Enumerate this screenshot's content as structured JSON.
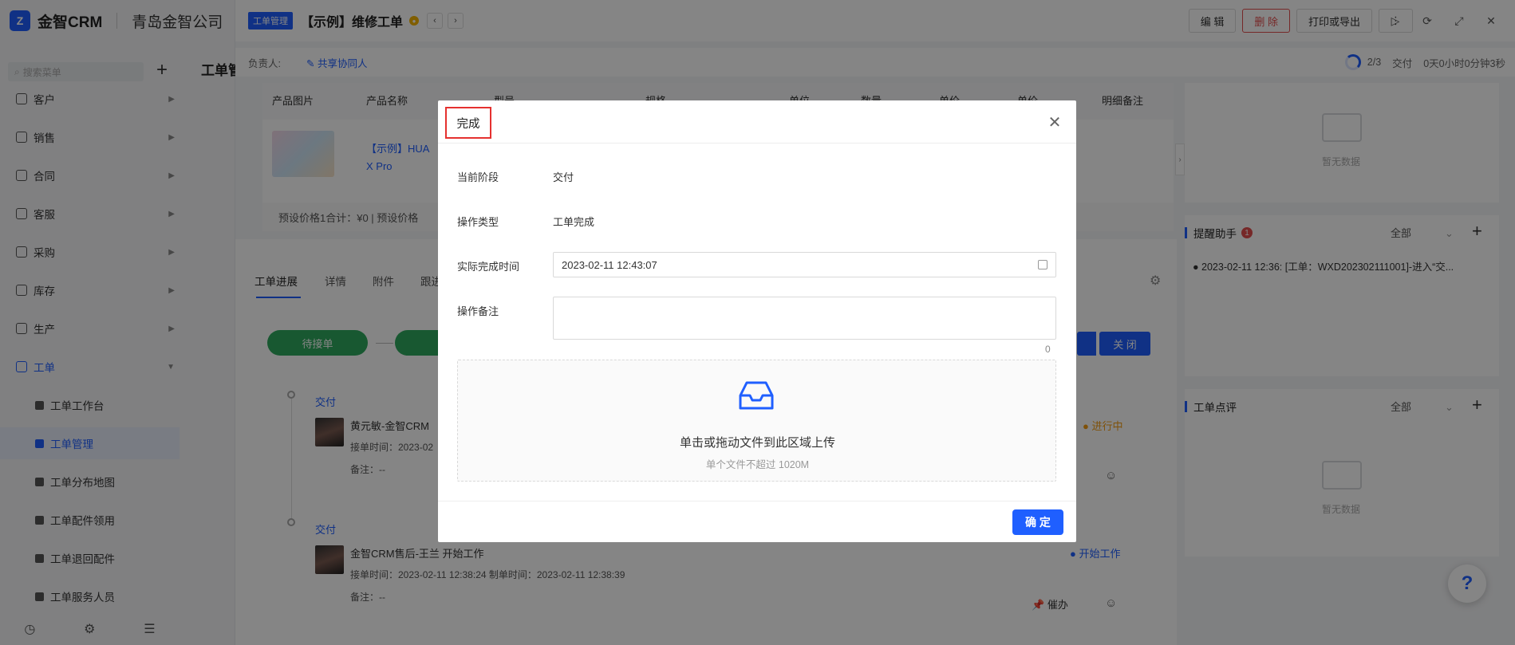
{
  "brand": {
    "logo": "Z",
    "name": "金智CRM",
    "company": "青岛金智公司"
  },
  "sidebar": {
    "search_placeholder": "搜索菜单",
    "items": [
      {
        "label": "客户"
      },
      {
        "label": "销售"
      },
      {
        "label": "合同"
      },
      {
        "label": "客服"
      },
      {
        "label": "采购"
      },
      {
        "label": "库存"
      },
      {
        "label": "生产"
      },
      {
        "label": "工单"
      }
    ],
    "sub_items": [
      {
        "label": "工单工作台"
      },
      {
        "label": "工单管理"
      },
      {
        "label": "工单分布地图"
      },
      {
        "label": "工单配件领用"
      },
      {
        "label": "工单退回配件"
      },
      {
        "label": "工单服务人员"
      }
    ]
  },
  "main": {
    "title": "工单管"
  },
  "panel": {
    "tag": "工单管理",
    "title": "【示例】维修工单",
    "buttons": {
      "edit": "编 辑",
      "delete": "删 除",
      "print": "打印或导出",
      "more": "⋮"
    },
    "owner_label": "负责人:",
    "share_label": "共享协同人",
    "progress": {
      "count": "2/3",
      "stage": "交付",
      "elapsed": "0天0小时0分钟3秒"
    },
    "table": {
      "headers": [
        "产品图片",
        "产品名称",
        "型号",
        "规格",
        "单位",
        "数量",
        "单价",
        "单价",
        "明细备注"
      ],
      "row": {
        "name": "【示例】HUAWEI Mate X Pro",
        "name_part": "【示例】HUA",
        "name_part2": "X Pro",
        "trail": "0"
      },
      "footer": "预设价格1合计：¥0 |   预设价格"
    },
    "tabs": [
      "工单进展",
      "详情",
      "附件",
      "跟进"
    ],
    "stages": {
      "s1": "待接单",
      "close": "关 闭"
    },
    "timeline": [
      {
        "stage": "交付",
        "text": "黄元敏-金智CRM",
        "sub": "接单时间：2023-02",
        "note": "备注：--",
        "status": "● 进行中"
      },
      {
        "stage": "交付",
        "text": "金智CRM售后-王兰 开始工作",
        "sub": "接单时间：2023-02-11 12:38:24  制单时间：2023-02-11 12:38:39",
        "note": "备注：--",
        "status": "● 开始工作",
        "urge": "催办"
      }
    ]
  },
  "right": {
    "empty_text": "暂无数据",
    "reminder": {
      "title": "提醒助手",
      "badge": "1",
      "filter": "全部",
      "item": "● 2023-02-11 12:36: [工单：WXD202302111001]-进入“交..."
    },
    "review": {
      "title": "工单点评",
      "filter": "全部"
    }
  },
  "modal": {
    "title": "完成",
    "fields": {
      "stage_label": "当前阶段",
      "stage_value": "交付",
      "type_label": "操作类型",
      "type_value": "工单完成",
      "time_label": "实际完成时间",
      "time_value": "2023-02-11 12:43:07",
      "remark_label": "操作备注",
      "remark_value": "",
      "remark_count": "0"
    },
    "upload": {
      "title": "单击或拖动文件到此区域上传",
      "hint": "单个文件不超过 1020M"
    },
    "confirm": "确 定"
  },
  "colors": {
    "accent": "#1f5fff",
    "danger": "#e34d4d",
    "success": "#2eaa5e",
    "highlight": "#e5312f"
  },
  "icons": [
    "search-icon",
    "plus-icon",
    "close-icon",
    "calendar-icon",
    "inbox-icon",
    "help-icon",
    "gear-icon",
    "edit-icon"
  ]
}
